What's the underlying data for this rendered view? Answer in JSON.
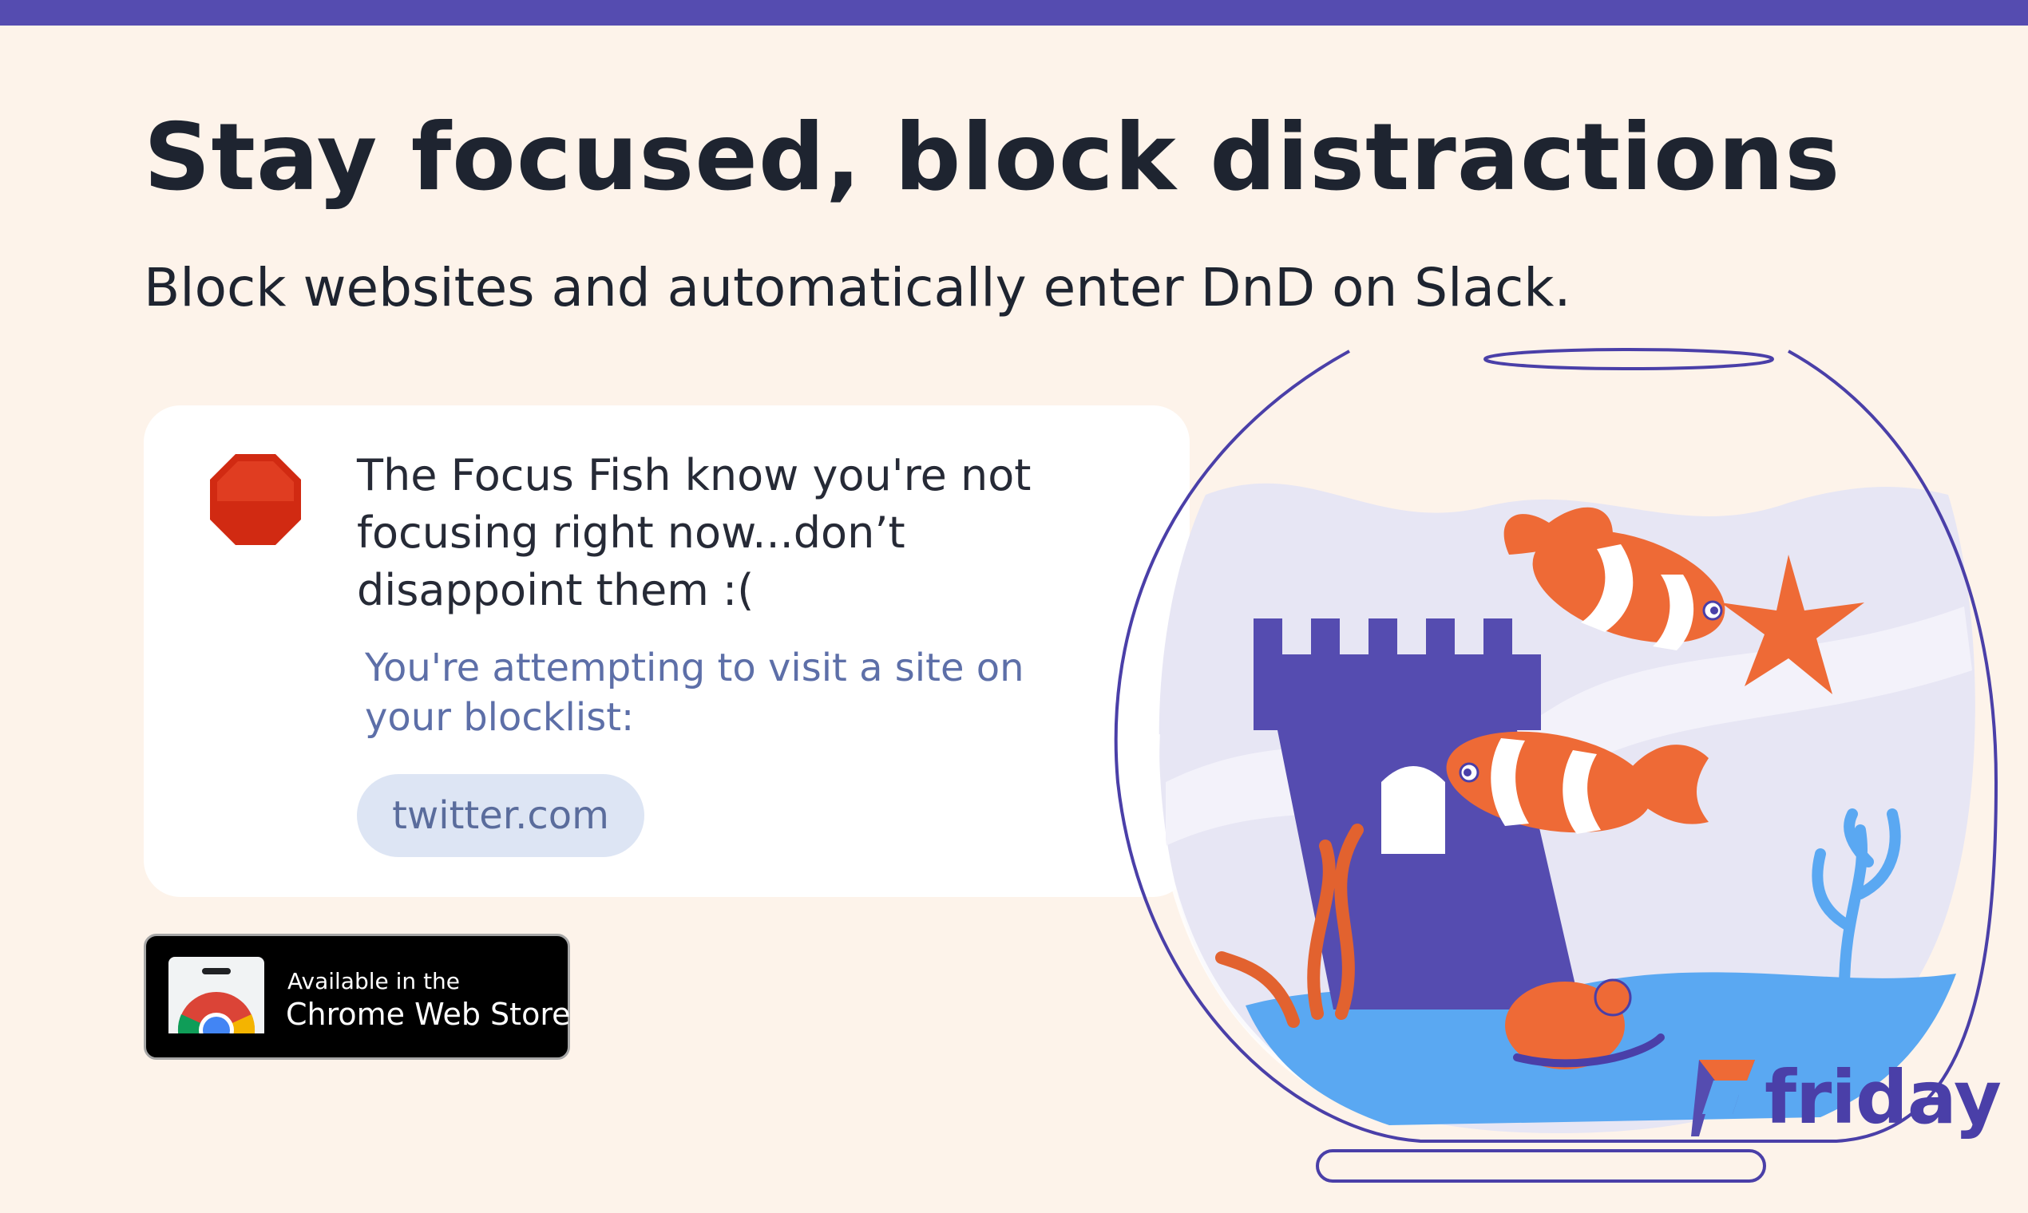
{
  "header": {
    "title": "Stay focused, block distractions",
    "subtitle": "Block websites and automatically enter DnD on Slack."
  },
  "block_card": {
    "icon": "stop-sign-icon",
    "message": "The Focus Fish know you're not focusing right now...don’t disappoint them :(",
    "description": "You're attempting to visit a site on your blocklist:",
    "blocked_site": "twitter.com"
  },
  "store_badge": {
    "line1": "Available in the",
    "line2": "Chrome Web Store",
    "icon": "chrome-icon"
  },
  "brand": {
    "name": "friday",
    "icon": "friday-logo-icon"
  },
  "colors": {
    "accent": "#554cb0",
    "background": "#fdf3ea",
    "stop_red": "#d12a12",
    "pill_bg": "#dde5f4",
    "fish_orange": "#ee6a36",
    "water_blue": "#5aa8f2"
  }
}
